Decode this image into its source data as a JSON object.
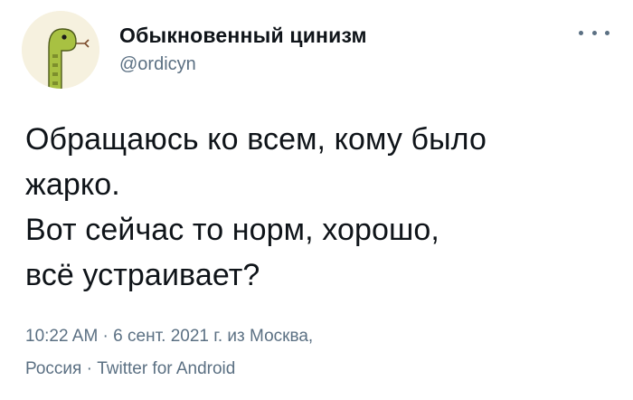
{
  "author": {
    "display_name": "Обыкновенный цинизм",
    "handle": "@ordicyn",
    "avatar_icon": "snake-avatar-icon"
  },
  "more_icon": "more-options-icon",
  "tweet": {
    "lines": [
      "Обращаюсь ко всем, кому было",
      "жарко.",
      "Вот сейчас то норм, хорошо,",
      "всё устраивает?"
    ]
  },
  "meta": {
    "line1": "10:22 AM · 6 сент. 2021 г. из Москва,",
    "location_cont": "Россия",
    "separator": " · ",
    "source": "Twitter for Android"
  },
  "colors": {
    "text": "#0f1419",
    "secondary": "#5b7083",
    "avatar_bg": "#f6f1df",
    "snake": "#a8c142"
  }
}
